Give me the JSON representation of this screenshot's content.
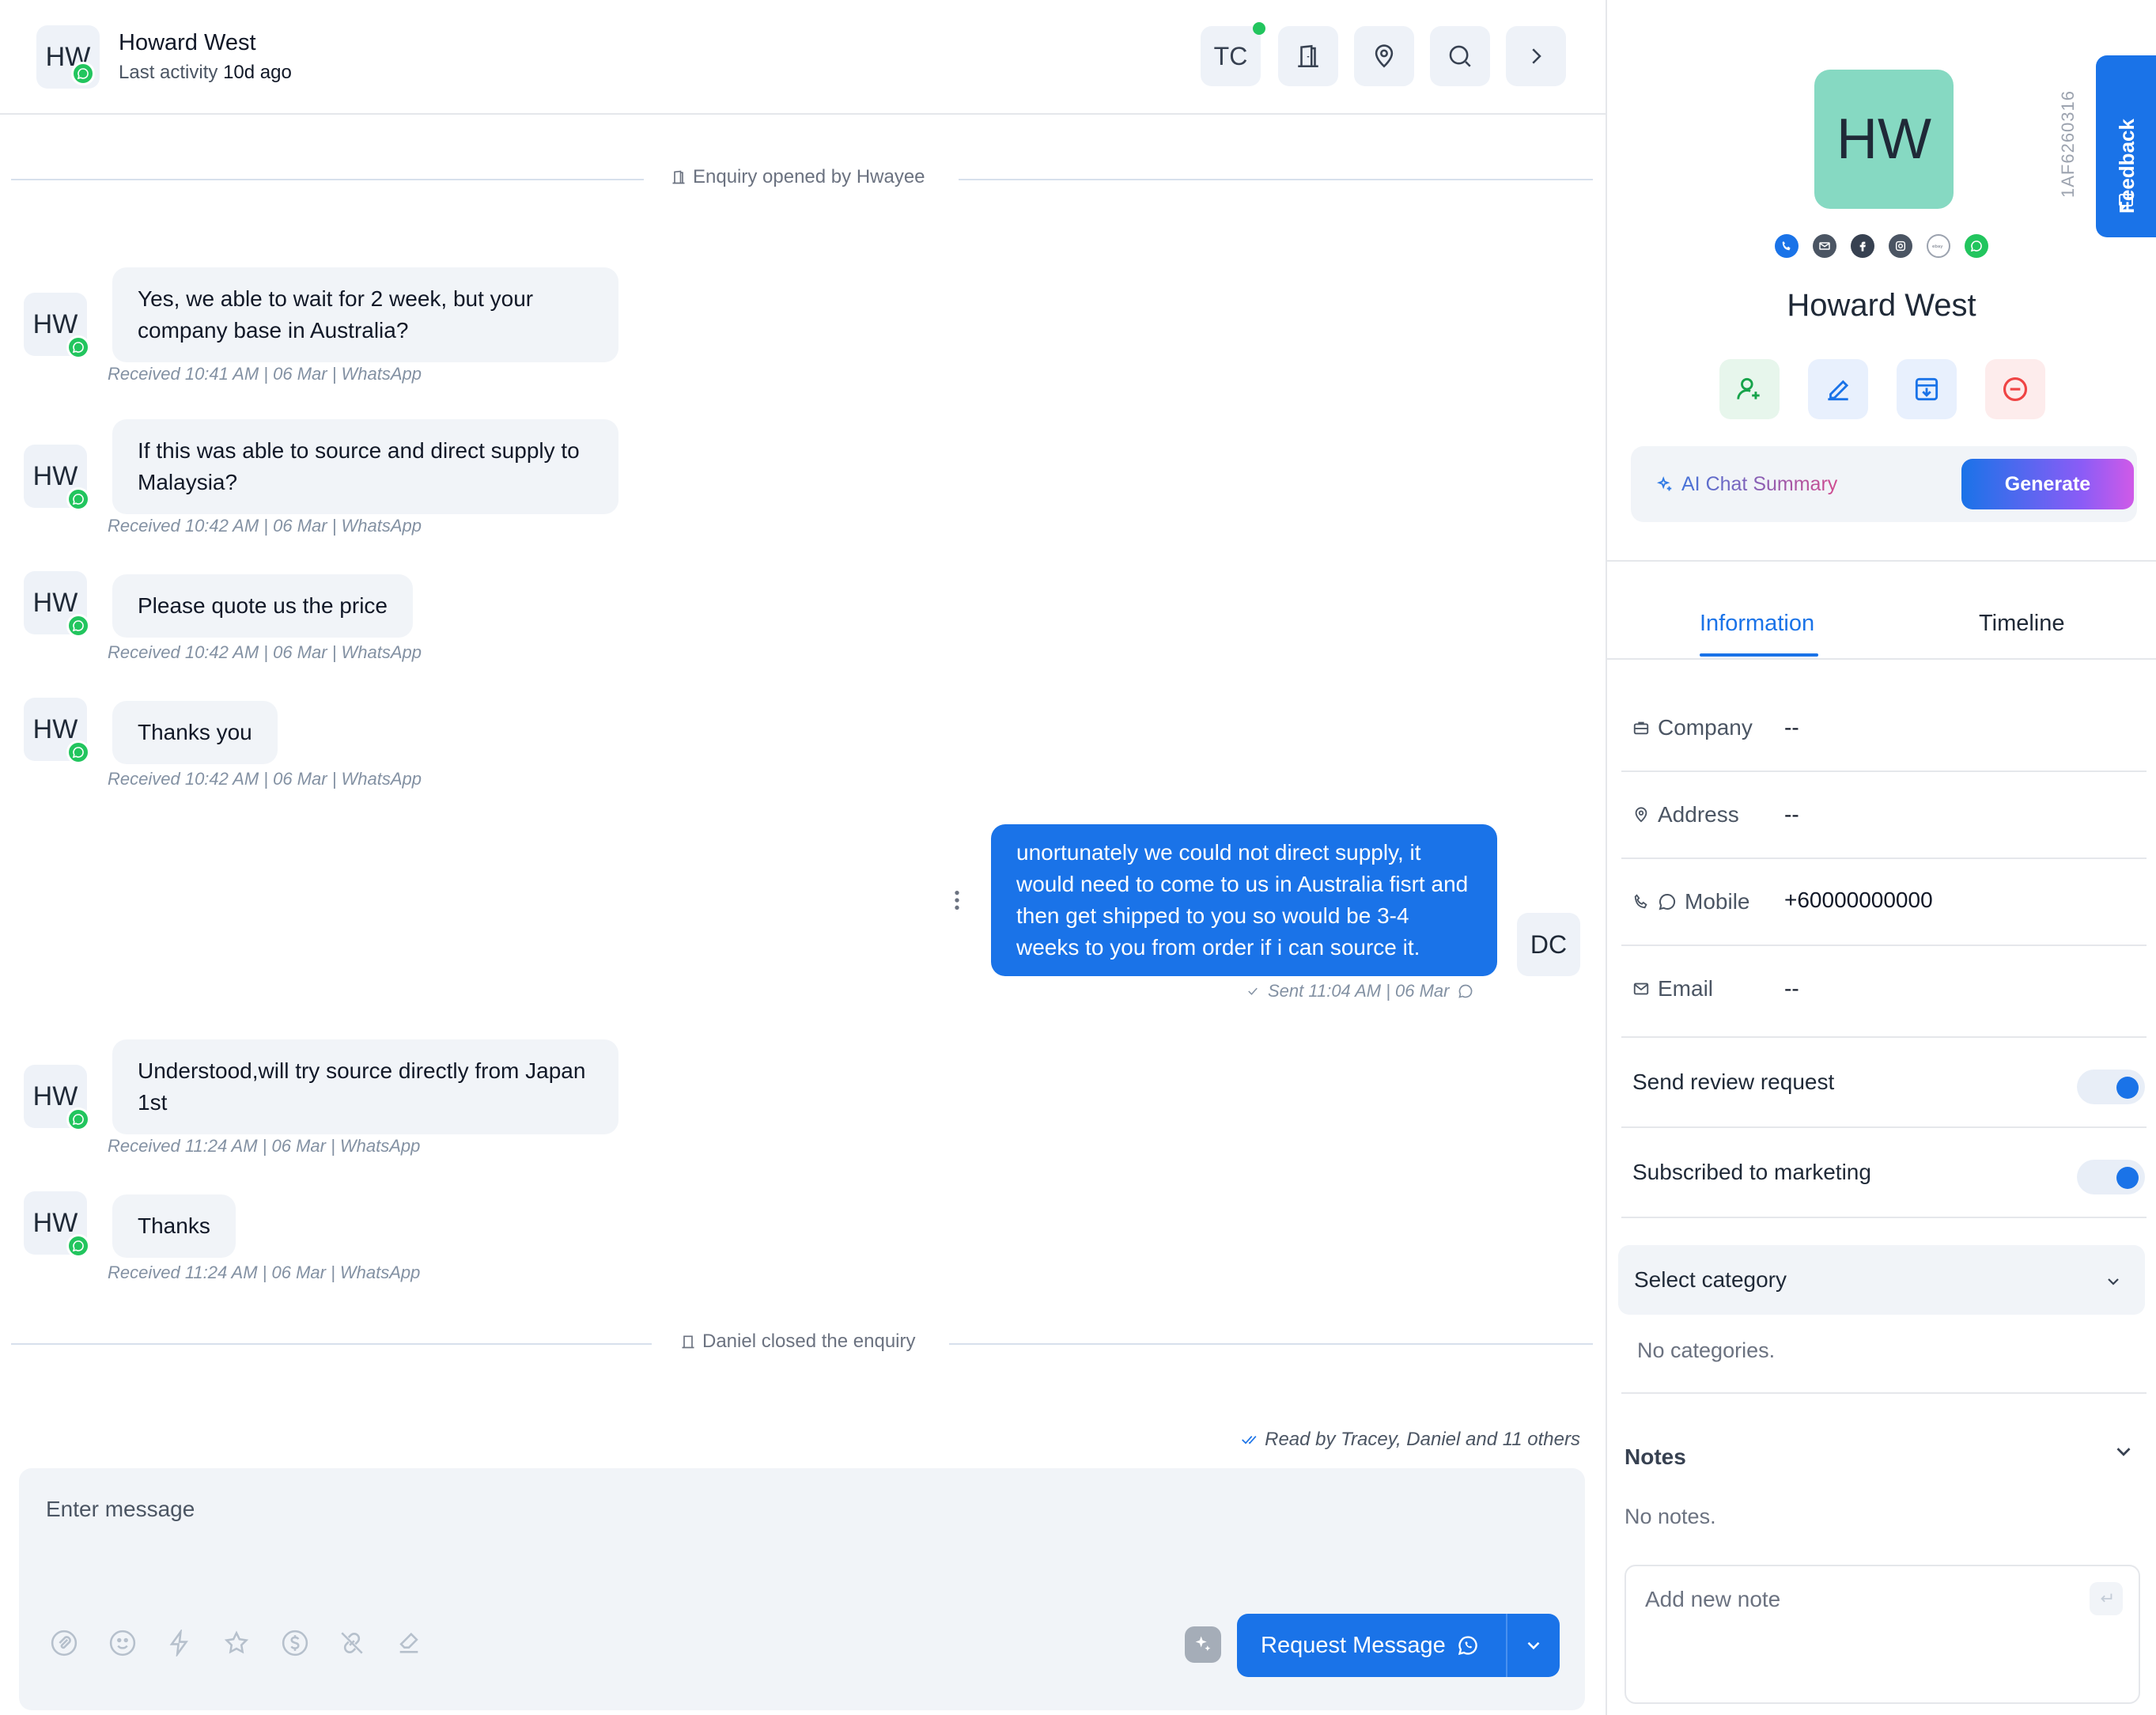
{
  "header": {
    "avatar_initials": "HW",
    "contact_name": "Howard West",
    "last_activity_label": "Last activity",
    "last_activity_value": "10d ago",
    "assignee_initials": "TC"
  },
  "system_events": {
    "opened": "Enquiry opened by Hwayee",
    "closed": "Daniel closed the enquiry"
  },
  "messages": [
    {
      "initials": "HW",
      "text": "Yes, we able to wait for 2 week, but your company base in Australia?",
      "meta": "Received 10:41 AM | 06 Mar | WhatsApp"
    },
    {
      "initials": "HW",
      "text": "If this was able to source and direct supply to Malaysia?",
      "meta": "Received 10:42 AM | 06 Mar | WhatsApp"
    },
    {
      "initials": "HW",
      "text": "Please quote us the price",
      "meta": "Received 10:42 AM | 06 Mar | WhatsApp"
    },
    {
      "initials": "HW",
      "text": "Thanks you",
      "meta": "Received 10:42 AM | 06 Mar | WhatsApp"
    },
    {
      "initials": "HW",
      "text": "Understood,will try source directly from Japan 1st",
      "meta": "Received 11:24 AM | 06 Mar | WhatsApp"
    },
    {
      "initials": "HW",
      "text": "Thanks",
      "meta": "Received 11:24 AM | 06 Mar | WhatsApp"
    }
  ],
  "outgoing": {
    "text": "unortunately we could not direct supply, it would need to come to us in Australia fisrt and then get shipped to you so would be 3-4 weeks to you from order if i can source it.",
    "meta": "Sent 11:04 AM  |  06 Mar",
    "initials": "DC"
  },
  "read_by": "Read by Tracey, Daniel and 11 others",
  "composer": {
    "placeholder": "Enter message",
    "send_label": "Request Message"
  },
  "profile": {
    "initials": "HW",
    "contact_id": "1AF6260316",
    "feedback_label": "Feedback",
    "name": "Howard West",
    "ai_summary_label": "AI Chat Summary",
    "generate_label": "Generate"
  },
  "tabs": {
    "information": "Information",
    "timeline": "Timeline"
  },
  "info": {
    "company_label": "Company",
    "company_value": "--",
    "address_label": "Address",
    "address_value": "--",
    "mobile_label": "Mobile",
    "mobile_value": "+60000000000",
    "email_label": "Email",
    "email_value": "--"
  },
  "toggles": {
    "review_label": "Send review request",
    "marketing_label": "Subscribed to marketing"
  },
  "category": {
    "placeholder": "Select category",
    "empty": "No categories."
  },
  "notes": {
    "title": "Notes",
    "empty": "No notes.",
    "placeholder": "Add new note"
  },
  "colors": {
    "accent": "#1a73e8",
    "whatsapp": "#22c55e",
    "avatar_bg": "#86d9c2"
  }
}
